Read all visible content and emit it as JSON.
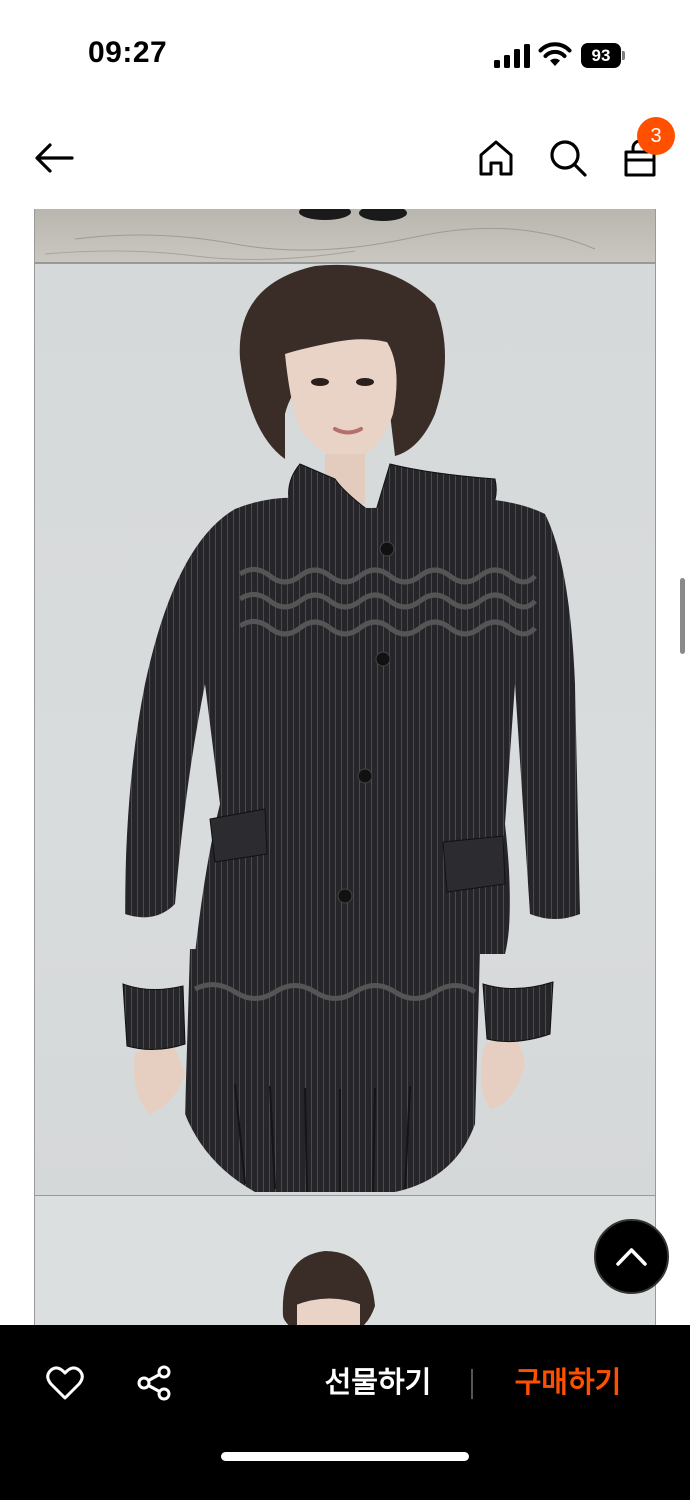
{
  "status_bar": {
    "time": "09:27",
    "battery": "93"
  },
  "nav": {
    "back_icon": "arrow-left-icon",
    "home_icon": "home-icon",
    "search_icon": "search-icon",
    "cart_icon": "shopping-bag-icon",
    "cart_count": "3"
  },
  "product_images": [
    {
      "name": "product-photo-shoes",
      "description": ""
    },
    {
      "name": "product-photo-model-front",
      "description": ""
    },
    {
      "name": "product-photo-model-partial",
      "description": ""
    }
  ],
  "bottom_bar": {
    "like_icon": "heart-icon",
    "share_icon": "share-icon",
    "gift_label": "선물하기",
    "buy_label": "구매하기"
  },
  "colors": {
    "accent": "#ff5000",
    "bar_bg": "#000000"
  }
}
